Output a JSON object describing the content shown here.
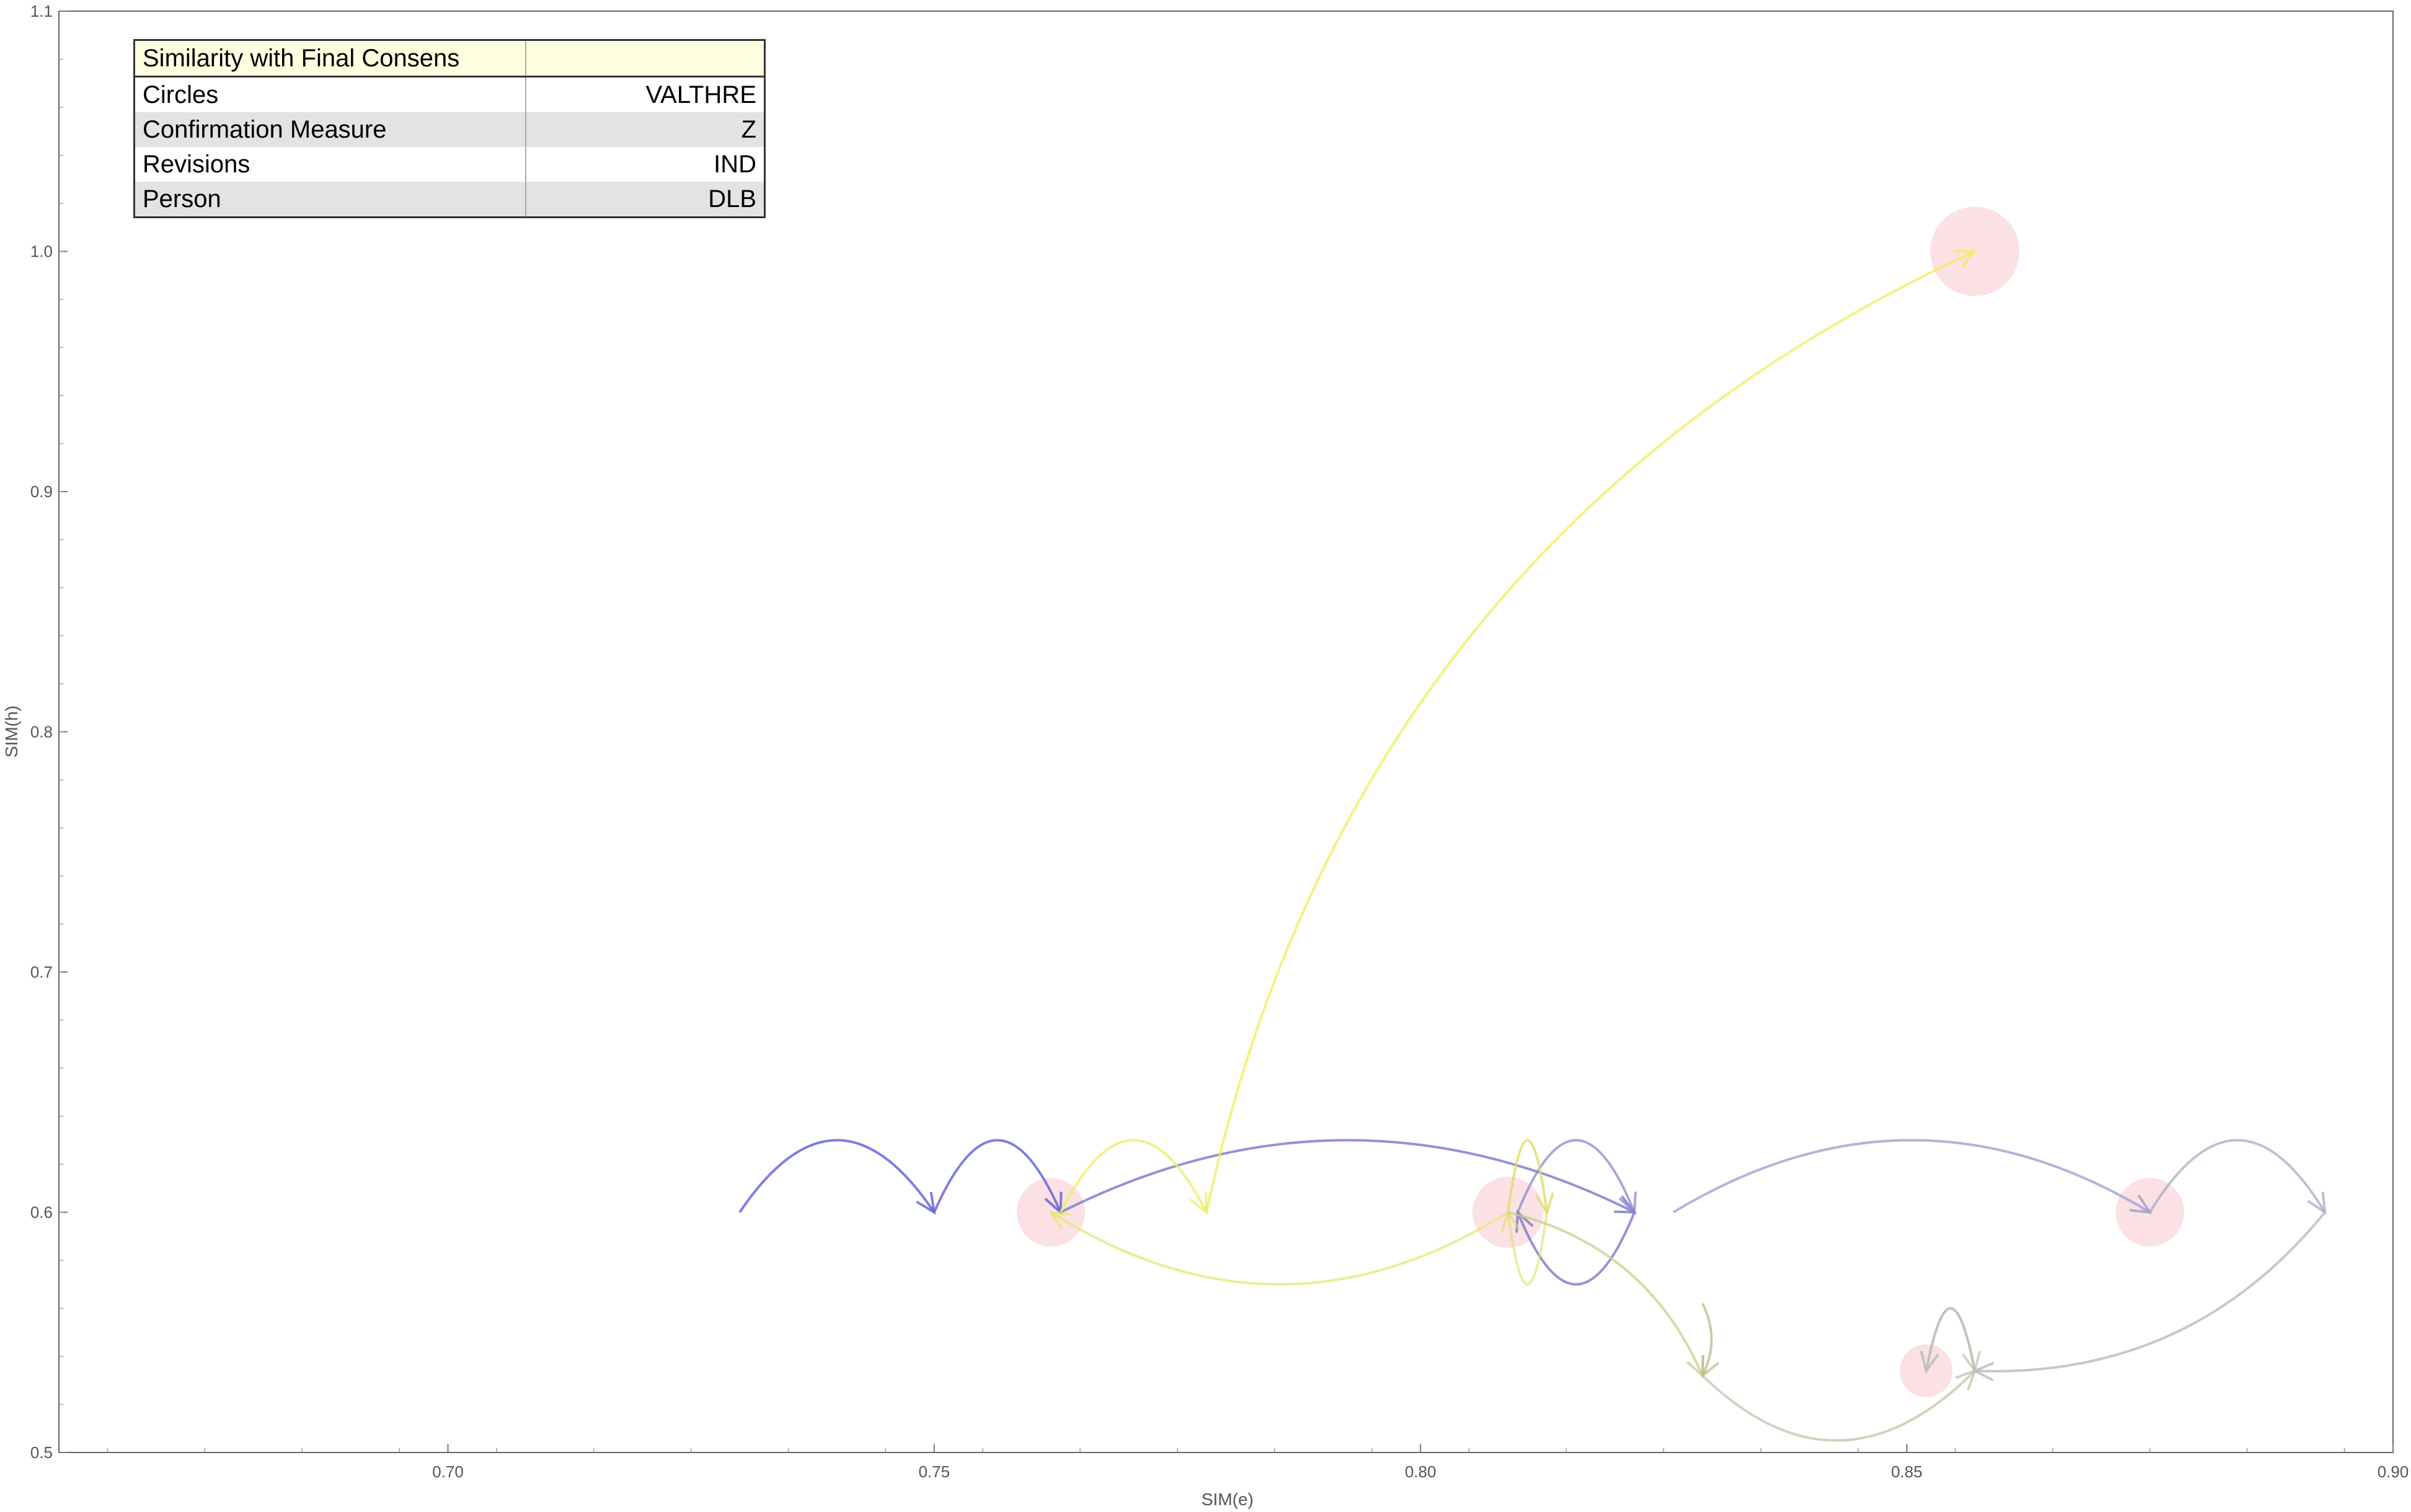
{
  "table": {
    "header": "Similarity with Final Consens",
    "rows": [
      {
        "label": "Circles",
        "value": "VALTHRE"
      },
      {
        "label": "Confirmation Measure",
        "value": "Z"
      },
      {
        "label": "Revisions",
        "value": "IND"
      },
      {
        "label": "Person",
        "value": "DLB"
      }
    ]
  },
  "chart_data": {
    "type": "scatter",
    "xlabel": "SIM(e)",
    "ylabel": "SIM(h)",
    "xlim": [
      0.66,
      0.9
    ],
    "ylim": [
      0.5,
      1.1
    ],
    "xticks": [
      "0.70",
      "0.75",
      "0.80",
      "0.85",
      "0.90"
    ],
    "yticks": [
      "0.5",
      "0.6",
      "0.7",
      "0.8",
      "0.9",
      "1.0",
      "1.1"
    ],
    "circle_color": "#f8c8cc",
    "circles": [
      {
        "x": 0.762,
        "y": 0.6,
        "size": 0.6
      },
      {
        "x": 0.809,
        "y": 0.6,
        "size": 0.65
      },
      {
        "x": 0.857,
        "y": 1.0,
        "size": 1.0
      },
      {
        "x": 0.875,
        "y": 0.6,
        "size": 0.6
      },
      {
        "x": 0.852,
        "y": 0.534,
        "size": 0.3
      }
    ],
    "arrows": [
      {
        "from": [
          0.73,
          0.6
        ],
        "to": [
          0.75,
          0.6
        ],
        "peak": 0.63,
        "color": "#6666dd",
        "opacity": 0.85
      },
      {
        "from": [
          0.75,
          0.6
        ],
        "to": [
          0.763,
          0.6
        ],
        "peak": 0.63,
        "color": "#6666dd",
        "opacity": 0.85
      },
      {
        "from": [
          0.763,
          0.6
        ],
        "to": [
          0.822,
          0.6
        ],
        "peak": 0.63,
        "color": "#7777cc",
        "opacity": 0.8
      },
      {
        "from": [
          0.822,
          0.6
        ],
        "to": [
          0.81,
          0.6
        ],
        "peak": 0.57,
        "color": "#7777cc",
        "opacity": 0.8
      },
      {
        "from": [
          0.81,
          0.6
        ],
        "to": [
          0.822,
          0.6
        ],
        "peak": 0.63,
        "color": "#8888cc",
        "opacity": 0.75
      },
      {
        "from": [
          0.826,
          0.6
        ],
        "to": [
          0.875,
          0.6
        ],
        "peak": 0.63,
        "color": "#9999cc",
        "opacity": 0.75
      },
      {
        "from": [
          0.875,
          0.6
        ],
        "to": [
          0.893,
          0.6
        ],
        "peak": 0.63,
        "color": "#aaaac4",
        "opacity": 0.75
      },
      {
        "from": [
          0.893,
          0.6
        ],
        "to": [
          0.857,
          0.534
        ],
        "peak": null,
        "color": "#b4b4b4",
        "opacity": 0.75
      },
      {
        "from": [
          0.857,
          0.534
        ],
        "to": [
          0.852,
          0.534
        ],
        "peak": 0.56,
        "color": "#b4b4b4",
        "opacity": 0.75
      },
      {
        "from": [
          0.852,
          0.534
        ],
        "to": [
          0.857,
          0.534
        ],
        "peak": 0.56,
        "color": "#c0c0b0",
        "opacity": 0.7
      },
      {
        "from": [
          0.763,
          0.6
        ],
        "to": [
          0.778,
          0.6
        ],
        "peak": 0.63,
        "color": "#eeee66",
        "opacity": 0.8
      },
      {
        "from": [
          0.778,
          0.6
        ],
        "to": [
          0.857,
          1.0
        ],
        "peak": null,
        "color": "#eeee55",
        "opacity": 0.75
      },
      {
        "from": [
          0.809,
          0.6
        ],
        "to": [
          0.762,
          0.6
        ],
        "peak": 0.57,
        "color": "#e6e677",
        "opacity": 0.75
      },
      {
        "from": [
          0.809,
          0.6
        ],
        "to": [
          0.813,
          0.6
        ],
        "peak": 0.63,
        "color": "#dddd66",
        "opacity": 0.8
      },
      {
        "from": [
          0.813,
          0.6
        ],
        "to": [
          0.809,
          0.6
        ],
        "peak": 0.57,
        "color": "#dddd66",
        "opacity": 0.6
      },
      {
        "from": [
          0.809,
          0.6
        ],
        "to": [
          0.829,
          0.532
        ],
        "peak": null,
        "color": "#cccc88",
        "opacity": 0.75
      },
      {
        "from": [
          0.829,
          0.562
        ],
        "to": [
          0.829,
          0.532
        ],
        "peak": null,
        "color": "#bbbb88",
        "opacity": 0.75
      },
      {
        "from": [
          0.829,
          0.532
        ],
        "to": [
          0.857,
          0.534
        ],
        "peak": 0.505,
        "color": "#c4c4a8",
        "opacity": 0.75
      }
    ]
  }
}
